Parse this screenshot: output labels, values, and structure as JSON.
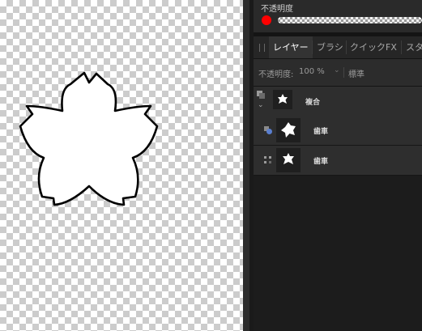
{
  "opacity_panel": {
    "title": "不透明度",
    "color_hex": "#ff0000",
    "opacity_level": 1.0
  },
  "tabs": [
    {
      "label": "レイヤー",
      "active": true
    },
    {
      "label": "ブラシ",
      "active": false
    },
    {
      "label": "クイックFX",
      "active": false
    },
    {
      "label": "スタ",
      "active": false
    }
  ],
  "layer_toolbar": {
    "opacity_label": "不透明度:",
    "opacity_value": "100 %",
    "blend_mode": "標準"
  },
  "layers": [
    {
      "name": "複合",
      "icon": "flower-composite-icon"
    },
    {
      "name": "歯車",
      "icon": "flower-gear-icon"
    },
    {
      "name": "歯車",
      "icon": "flower-gear-icon"
    }
  ],
  "colors": {
    "panel_bg": "#1c1c1c",
    "accent_red": "#ff0000",
    "canvas_checker": "#cccccc"
  }
}
